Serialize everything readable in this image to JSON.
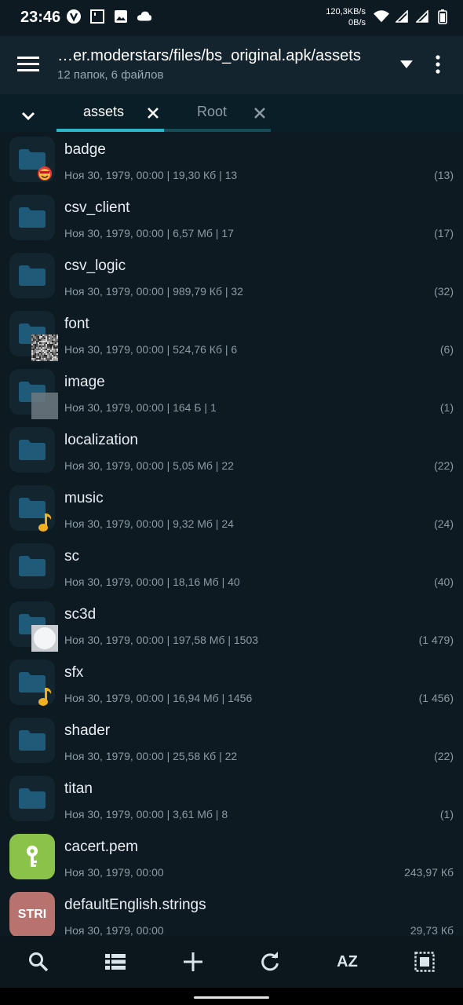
{
  "status_bar": {
    "time": "23:46",
    "net_up": "120,3KB/s",
    "net_down": "0B/s",
    "left_icons": [
      "v-app-icon",
      "square-notification-icon",
      "image-icon",
      "cloud-icon"
    ],
    "right_icons": [
      "wifi-icon",
      "signal-icon",
      "signal-icon",
      "battery-icon"
    ]
  },
  "appbar": {
    "path": "…er.moderstars/files/bs_original.apk/assets",
    "summary": "12 папок, 6 файлов"
  },
  "tabs": [
    {
      "label": "assets",
      "active": true
    },
    {
      "label": "Root",
      "active": false
    }
  ],
  "colors": {
    "accent": "#2ab7c9",
    "folder": "#1f5a78",
    "music_badge": "#f2b01e",
    "pem_icon_bg": "#8bc34a",
    "strings_icon_bg": "#b8736f"
  },
  "items": [
    {
      "name": "badge",
      "meta": "Ноя 30, 1979, 00:00 | 19,30 Кб | 13",
      "count": "(13)",
      "kind": "folder",
      "overlay": "emoji-face"
    },
    {
      "name": "csv_client",
      "meta": "Ноя 30, 1979, 00:00 | 6,57 Мб | 17",
      "count": "(17)",
      "kind": "folder",
      "overlay": ""
    },
    {
      "name": "csv_logic",
      "meta": "Ноя 30, 1979, 00:00 | 989,79 Кб | 32",
      "count": "(32)",
      "kind": "folder",
      "overlay": ""
    },
    {
      "name": "font",
      "meta": "Ноя 30, 1979, 00:00 | 524,76 Кб | 6",
      "count": "(6)",
      "kind": "folder",
      "overlay": "noise-thumbnail"
    },
    {
      "name": "image",
      "meta": "Ноя 30, 1979, 00:00 | 164 Б | 1",
      "count": "(1)",
      "kind": "folder",
      "overlay": "gray-thumbnail"
    },
    {
      "name": "localization",
      "meta": "Ноя 30, 1979, 00:00 | 5,05 Мб | 22",
      "count": "(22)",
      "kind": "folder",
      "overlay": ""
    },
    {
      "name": "music",
      "meta": "Ноя 30, 1979, 00:00 | 9,32 Мб | 24",
      "count": "(24)",
      "kind": "folder",
      "overlay": "music-note"
    },
    {
      "name": "sc",
      "meta": "Ноя 30, 1979, 00:00 | 18,16 Мб | 40",
      "count": "(40)",
      "kind": "folder",
      "overlay": ""
    },
    {
      "name": "sc3d",
      "meta": "Ноя 30, 1979, 00:00 | 197,58 Мб | 1503",
      "count": "(1 479)",
      "kind": "folder",
      "overlay": "white-circle-thumbnail"
    },
    {
      "name": "sfx",
      "meta": "Ноя 30, 1979, 00:00 | 16,94 Мб | 1456",
      "count": "(1 456)",
      "kind": "folder",
      "overlay": "music-note"
    },
    {
      "name": "shader",
      "meta": "Ноя 30, 1979, 00:00 | 25,58 Кб | 22",
      "count": "(22)",
      "kind": "folder",
      "overlay": ""
    },
    {
      "name": "titan",
      "meta": "Ноя 30, 1979, 00:00 | 3,61 Мб | 8",
      "count": "(1)",
      "kind": "folder",
      "overlay": ""
    },
    {
      "name": "cacert.pem",
      "meta": "Ноя 30, 1979, 00:00",
      "count": "243,97 Кб",
      "kind": "file-pem",
      "overlay": ""
    },
    {
      "name": "defaultEnglish.strings",
      "meta": "Ноя 30, 1979, 00:00",
      "count": "29,73 Кб",
      "kind": "file-strings",
      "icon_text": "STRI",
      "overlay": ""
    }
  ],
  "bottom_bar": {
    "buttons": [
      "search-icon",
      "list-view-icon",
      "add-icon",
      "refresh-icon",
      "sort-az",
      "select-all-icon"
    ],
    "sort_label": "AZ"
  }
}
